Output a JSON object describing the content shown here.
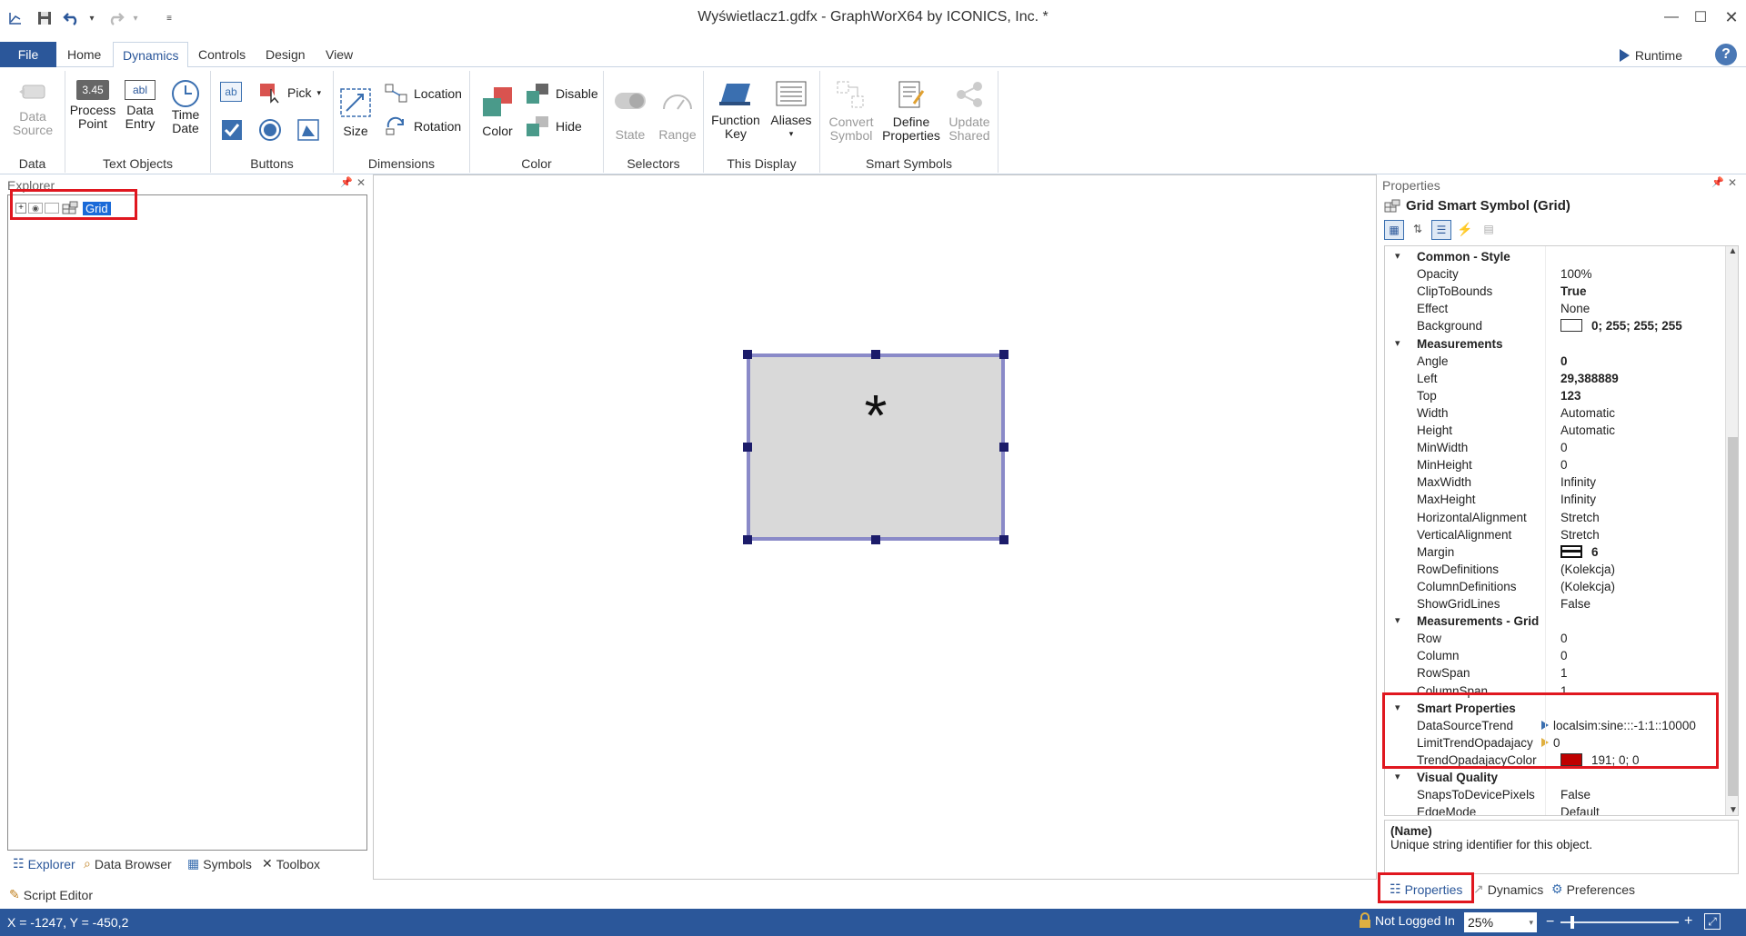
{
  "window": {
    "title": "Wyświetlacz1.gdfx - GraphWorX64 by ICONICS, Inc. *"
  },
  "tabs": [
    "File",
    "Home",
    "Dynamics",
    "Controls",
    "Design",
    "View"
  ],
  "runtime_label": "Runtime",
  "help_label": "?",
  "ribbon": {
    "data": {
      "label": "Data",
      "data_source": [
        "Data",
        "Source"
      ]
    },
    "text_objects": {
      "label": "Text Objects",
      "process_point": [
        "Process",
        "Point"
      ],
      "process_point_icon_text": "3.45",
      "data_entry": [
        "Data",
        "Entry"
      ],
      "data_entry_icon_text": "abl",
      "time_date": [
        "Time",
        "Date"
      ]
    },
    "buttons": {
      "label": "Buttons",
      "pick": "Pick",
      "ab_icon_text": "ab"
    },
    "dimensions": {
      "label": "Dimensions",
      "size": "Size",
      "location": "Location",
      "rotation": "Rotation"
    },
    "color": {
      "label": "Color",
      "color": "Color",
      "disable": "Disable",
      "hide": "Hide"
    },
    "selectors": {
      "label": "Selectors",
      "state": "State",
      "range": "Range"
    },
    "this_display": {
      "label": "This Display",
      "function_key": [
        "Function",
        "Key"
      ],
      "aliases": "Aliases"
    },
    "smart_symbols": {
      "label": "Smart Symbols",
      "convert_symbol": [
        "Convert",
        "Symbol"
      ],
      "define_properties": [
        "Define",
        "Properties"
      ],
      "update_shared": [
        "Update",
        "Shared"
      ]
    }
  },
  "explorer": {
    "title": "Explorer",
    "tree_item": "Grid",
    "bottom_tabs": [
      "Explorer",
      "Data Browser",
      "Symbols",
      "Toolbox"
    ],
    "script_editor": "Script Editor"
  },
  "canvas": {
    "placeholder_glyph": "*"
  },
  "properties": {
    "title": "Properties",
    "object_title": "Grid Smart Symbol (Grid)",
    "categories": [
      {
        "name": "Common - Style",
        "rows": [
          {
            "name": "Opacity",
            "value": "100%"
          },
          {
            "name": "ClipToBounds",
            "value": "True",
            "bold": true
          },
          {
            "name": "Effect",
            "value": "None"
          },
          {
            "name": "Background",
            "value": "0; 255; 255; 255",
            "bold": true,
            "swatch": "#ffffff"
          }
        ]
      },
      {
        "name": "Measurements",
        "rows": [
          {
            "name": "Angle",
            "value": "0",
            "bold": true
          },
          {
            "name": "Left",
            "value": "29,388889",
            "bold": true
          },
          {
            "name": "Top",
            "value": "123",
            "bold": true
          },
          {
            "name": "Width",
            "value": "Automatic"
          },
          {
            "name": "Height",
            "value": "Automatic"
          },
          {
            "name": "MinWidth",
            "value": "0"
          },
          {
            "name": "MinHeight",
            "value": "0"
          },
          {
            "name": "MaxWidth",
            "value": "Infinity"
          },
          {
            "name": "MaxHeight",
            "value": "Infinity"
          },
          {
            "name": "HorizontalAlignment",
            "value": "Stretch"
          },
          {
            "name": "VerticalAlignment",
            "value": "Stretch"
          },
          {
            "name": "Margin",
            "value": "6",
            "bold": true,
            "margin_icon": true
          },
          {
            "name": "RowDefinitions",
            "value": "(Kolekcja)"
          },
          {
            "name": "ColumnDefinitions",
            "value": "(Kolekcja)"
          },
          {
            "name": "ShowGridLines",
            "value": "False"
          }
        ]
      },
      {
        "name": "Measurements - Grid",
        "rows": [
          {
            "name": "Row",
            "value": "0"
          },
          {
            "name": "Column",
            "value": "0"
          },
          {
            "name": "RowSpan",
            "value": "1"
          },
          {
            "name": "ColumnSpan",
            "value": "1"
          }
        ]
      },
      {
        "name": "Smart Properties",
        "rows": [
          {
            "name": "DataSourceTrend",
            "value": "localsim:sine:::-1:1::10000",
            "tag": "#3a6fb0"
          },
          {
            "name": "LimitTrendOpadajacy",
            "value": "0",
            "tag": "#e0b040"
          },
          {
            "name": "TrendOpadajacyColor",
            "value": "191; 0; 0",
            "swatch": "#bf0000"
          }
        ]
      },
      {
        "name": "Visual Quality",
        "rows": [
          {
            "name": "SnapsToDevicePixels",
            "value": "False"
          },
          {
            "name": "EdgeMode",
            "value": "Default"
          }
        ]
      }
    ],
    "description_title": "(Name)",
    "description_text": "Unique string identifier for this object.",
    "bottom_tabs": [
      "Properties",
      "Dynamics",
      "Preferences"
    ]
  },
  "status": {
    "coords": "X = -1247, Y = -450,2",
    "login": "Not Logged In",
    "zoom": "25%",
    "zoom_level": 0.25
  },
  "colors": {
    "accent": "#2b579a",
    "highlight": "#e0171f",
    "selection": "#1a6ad8"
  }
}
